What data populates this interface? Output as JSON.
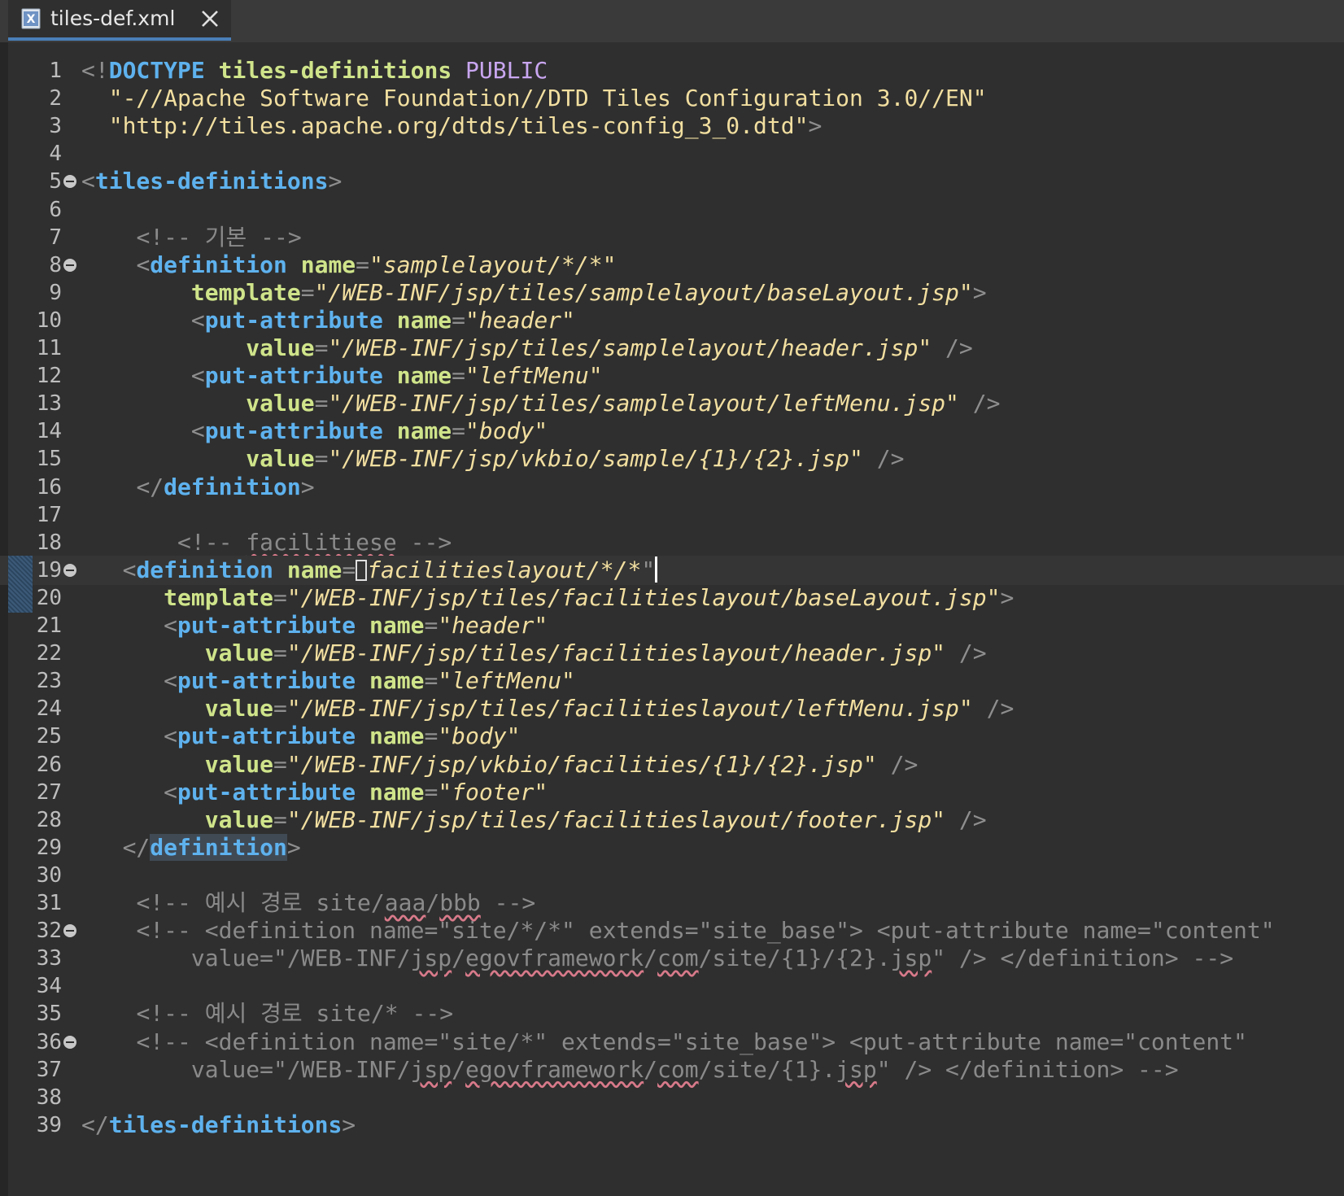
{
  "tab": {
    "filename": "tiles-def.xml",
    "icon": "xml-file-icon",
    "close_icon": "close-icon"
  },
  "colors": {
    "background": "#2f2f2f",
    "tag": "#5eb2ee",
    "attribute": "#cfe48a",
    "value": "#f2dfa0",
    "comment": "#8a8a8a",
    "keyword": "#c9a6f0",
    "line_number": "#bdbdbd",
    "tab_underline": "#4a7fb8"
  },
  "editor": {
    "current_line": 19,
    "lines": [
      {
        "n": "1",
        "fold": false,
        "tokens": [
          [
            "br",
            "<!"
          ],
          [
            "tag",
            "DOCTYPE"
          ],
          [
            "txt",
            " "
          ],
          [
            "attr",
            "tiles-definitions"
          ],
          [
            "txt",
            " "
          ],
          [
            "kw",
            "PUBLIC"
          ]
        ]
      },
      {
        "n": "2",
        "fold": false,
        "tokens": [
          [
            "txt",
            "  "
          ],
          [
            "dt",
            "\"-//Apache Software Foundation//DTD Tiles Configuration 3.0//EN\""
          ]
        ]
      },
      {
        "n": "3",
        "fold": false,
        "tokens": [
          [
            "txt",
            "  "
          ],
          [
            "dt",
            "\"http://tiles.apache.org/dtds/tiles-config_3_0.dtd\""
          ],
          [
            "br",
            ">"
          ]
        ]
      },
      {
        "n": "4",
        "fold": false,
        "tokens": []
      },
      {
        "n": "5",
        "fold": true,
        "tokens": [
          [
            "br",
            "<"
          ],
          [
            "tag",
            "tiles-definitions"
          ],
          [
            "br",
            ">"
          ]
        ]
      },
      {
        "n": "6",
        "fold": false,
        "tokens": []
      },
      {
        "n": "7",
        "fold": false,
        "tokens": [
          [
            "txt",
            "    "
          ],
          [
            "cm",
            "<!-- 기본 -->"
          ]
        ]
      },
      {
        "n": "8",
        "fold": true,
        "tokens": [
          [
            "txt",
            "    "
          ],
          [
            "br",
            "<"
          ],
          [
            "tag",
            "definition"
          ],
          [
            "txt",
            " "
          ],
          [
            "attr",
            "name"
          ],
          [
            "br",
            "="
          ],
          [
            "val",
            "\"samplelayout/*/*\""
          ]
        ]
      },
      {
        "n": "9",
        "fold": false,
        "tokens": [
          [
            "txt",
            "        "
          ],
          [
            "attr",
            "template"
          ],
          [
            "br",
            "="
          ],
          [
            "val",
            "\"/WEB-INF/jsp/tiles/samplelayout/baseLayout.jsp\""
          ],
          [
            "br",
            ">"
          ]
        ]
      },
      {
        "n": "10",
        "fold": false,
        "tokens": [
          [
            "txt",
            "        "
          ],
          [
            "br",
            "<"
          ],
          [
            "tag",
            "put-attribute"
          ],
          [
            "txt",
            " "
          ],
          [
            "attr",
            "name"
          ],
          [
            "br",
            "="
          ],
          [
            "val",
            "\"header\""
          ]
        ]
      },
      {
        "n": "11",
        "fold": false,
        "tokens": [
          [
            "txt",
            "            "
          ],
          [
            "attr",
            "value"
          ],
          [
            "br",
            "="
          ],
          [
            "val",
            "\"/WEB-INF/jsp/tiles/samplelayout/header.jsp\""
          ],
          [
            "txt",
            " "
          ],
          [
            "br",
            "/>"
          ]
        ]
      },
      {
        "n": "12",
        "fold": false,
        "tokens": [
          [
            "txt",
            "        "
          ],
          [
            "br",
            "<"
          ],
          [
            "tag",
            "put-attribute"
          ],
          [
            "txt",
            " "
          ],
          [
            "attr",
            "name"
          ],
          [
            "br",
            "="
          ],
          [
            "val",
            "\"leftMenu\""
          ]
        ]
      },
      {
        "n": "13",
        "fold": false,
        "tokens": [
          [
            "txt",
            "            "
          ],
          [
            "attr",
            "value"
          ],
          [
            "br",
            "="
          ],
          [
            "val",
            "\"/WEB-INF/jsp/tiles/samplelayout/leftMenu.jsp\""
          ],
          [
            "txt",
            " "
          ],
          [
            "br",
            "/>"
          ]
        ]
      },
      {
        "n": "14",
        "fold": false,
        "tokens": [
          [
            "txt",
            "        "
          ],
          [
            "br",
            "<"
          ],
          [
            "tag",
            "put-attribute"
          ],
          [
            "txt",
            " "
          ],
          [
            "attr",
            "name"
          ],
          [
            "br",
            "="
          ],
          [
            "val",
            "\"body\""
          ]
        ]
      },
      {
        "n": "15",
        "fold": false,
        "tokens": [
          [
            "txt",
            "            "
          ],
          [
            "attr",
            "value"
          ],
          [
            "br",
            "="
          ],
          [
            "val",
            "\"/WEB-INF/jsp/vkbio/sample/{1}/{2}.jsp\""
          ],
          [
            "txt",
            " "
          ],
          [
            "br",
            "/>"
          ]
        ]
      },
      {
        "n": "16",
        "fold": false,
        "tokens": [
          [
            "txt",
            "    "
          ],
          [
            "br",
            "</"
          ],
          [
            "tag",
            "definition"
          ],
          [
            "br",
            ">"
          ]
        ]
      },
      {
        "n": "17",
        "fold": false,
        "tokens": []
      },
      {
        "n": "18",
        "fold": false,
        "tokens": [
          [
            "txt",
            "       "
          ],
          [
            "cm",
            "<!-- "
          ],
          [
            "cmsq",
            "facilitiese"
          ],
          [
            "cm",
            " -->"
          ]
        ]
      },
      {
        "n": "19",
        "fold": true,
        "tokens": [
          [
            "txt",
            "   "
          ],
          [
            "br",
            "<"
          ],
          [
            "tag",
            "definition"
          ],
          [
            "txt",
            " "
          ],
          [
            "attr",
            "name"
          ],
          [
            "br",
            "="
          ],
          [
            "cursorbox",
            ""
          ],
          [
            "val",
            "facilitieslayout/*/*"
          ],
          [
            "br",
            "\""
          ],
          [
            "caret",
            ""
          ]
        ]
      },
      {
        "n": "20",
        "fold": false,
        "tokens": [
          [
            "txt",
            "      "
          ],
          [
            "attr",
            "template"
          ],
          [
            "br",
            "="
          ],
          [
            "val",
            "\"/WEB-INF/jsp/tiles/facilitieslayout/baseLayout.jsp\""
          ],
          [
            "br",
            ">"
          ]
        ]
      },
      {
        "n": "21",
        "fold": false,
        "tokens": [
          [
            "txt",
            "      "
          ],
          [
            "br",
            "<"
          ],
          [
            "tag",
            "put-attribute"
          ],
          [
            "txt",
            " "
          ],
          [
            "attr",
            "name"
          ],
          [
            "br",
            "="
          ],
          [
            "val",
            "\"header\""
          ]
        ]
      },
      {
        "n": "22",
        "fold": false,
        "tokens": [
          [
            "txt",
            "         "
          ],
          [
            "attr",
            "value"
          ],
          [
            "br",
            "="
          ],
          [
            "val",
            "\"/WEB-INF/jsp/tiles/facilitieslayout/header.jsp\""
          ],
          [
            "txt",
            " "
          ],
          [
            "br",
            "/>"
          ]
        ]
      },
      {
        "n": "23",
        "fold": false,
        "tokens": [
          [
            "txt",
            "      "
          ],
          [
            "br",
            "<"
          ],
          [
            "tag",
            "put-attribute"
          ],
          [
            "txt",
            " "
          ],
          [
            "attr",
            "name"
          ],
          [
            "br",
            "="
          ],
          [
            "val",
            "\"leftMenu\""
          ]
        ]
      },
      {
        "n": "24",
        "fold": false,
        "tokens": [
          [
            "txt",
            "         "
          ],
          [
            "attr",
            "value"
          ],
          [
            "br",
            "="
          ],
          [
            "val",
            "\"/WEB-INF/jsp/tiles/facilitieslayout/leftMenu.jsp\""
          ],
          [
            "txt",
            " "
          ],
          [
            "br",
            "/>"
          ]
        ]
      },
      {
        "n": "25",
        "fold": false,
        "tokens": [
          [
            "txt",
            "      "
          ],
          [
            "br",
            "<"
          ],
          [
            "tag",
            "put-attribute"
          ],
          [
            "txt",
            " "
          ],
          [
            "attr",
            "name"
          ],
          [
            "br",
            "="
          ],
          [
            "val",
            "\"body\""
          ]
        ]
      },
      {
        "n": "26",
        "fold": false,
        "tokens": [
          [
            "txt",
            "         "
          ],
          [
            "attr",
            "value"
          ],
          [
            "br",
            "="
          ],
          [
            "val",
            "\"/WEB-INF/jsp/vkbio/facilities/{1}/{2}.jsp\""
          ],
          [
            "txt",
            " "
          ],
          [
            "br",
            "/>"
          ]
        ]
      },
      {
        "n": "27",
        "fold": false,
        "tokens": [
          [
            "txt",
            "      "
          ],
          [
            "br",
            "<"
          ],
          [
            "tag",
            "put-attribute"
          ],
          [
            "txt",
            " "
          ],
          [
            "attr",
            "name"
          ],
          [
            "br",
            "="
          ],
          [
            "val",
            "\"footer\""
          ]
        ]
      },
      {
        "n": "28",
        "fold": false,
        "tokens": [
          [
            "txt",
            "         "
          ],
          [
            "attr",
            "value"
          ],
          [
            "br",
            "="
          ],
          [
            "val",
            "\"/WEB-INF/jsp/tiles/facilitieslayout/footer.jsp\""
          ],
          [
            "txt",
            " "
          ],
          [
            "br",
            "/>"
          ]
        ]
      },
      {
        "n": "29",
        "fold": false,
        "tokens": [
          [
            "txt",
            "   "
          ],
          [
            "br",
            "</"
          ],
          [
            "tagsel",
            "definition"
          ],
          [
            "br",
            ">"
          ]
        ]
      },
      {
        "n": "30",
        "fold": false,
        "tokens": []
      },
      {
        "n": "31",
        "fold": false,
        "tokens": [
          [
            "txt",
            "    "
          ],
          [
            "cm",
            "<!-- 예시 경로 site/"
          ],
          [
            "cmsq",
            "aaa"
          ],
          [
            "cm",
            "/"
          ],
          [
            "cmsq",
            "bbb"
          ],
          [
            "cm",
            " -->"
          ]
        ]
      },
      {
        "n": "32",
        "fold": true,
        "tokens": [
          [
            "txt",
            "    "
          ],
          [
            "cm",
            "<!-- <definition name=\"site/*/*\" extends=\"site_base\"> <put-attribute name=\"content\""
          ]
        ]
      },
      {
        "n": "33",
        "fold": false,
        "tokens": [
          [
            "txt",
            "        "
          ],
          [
            "cm",
            "value=\"/WEB-INF/"
          ],
          [
            "cmsq",
            "jsp"
          ],
          [
            "cm",
            "/"
          ],
          [
            "cmsq",
            "egovframework"
          ],
          [
            "cm",
            "/"
          ],
          [
            "cmsq",
            "com"
          ],
          [
            "cm",
            "/site/{1}/{2}."
          ],
          [
            "cmsq",
            "jsp"
          ],
          [
            "cm",
            "\" /> </definition> -->"
          ]
        ]
      },
      {
        "n": "34",
        "fold": false,
        "tokens": []
      },
      {
        "n": "35",
        "fold": false,
        "tokens": [
          [
            "txt",
            "    "
          ],
          [
            "cm",
            "<!-- 예시 경로 site/* -->"
          ]
        ]
      },
      {
        "n": "36",
        "fold": true,
        "tokens": [
          [
            "txt",
            "    "
          ],
          [
            "cm",
            "<!-- <definition name=\"site/*\" extends=\"site_base\"> <put-attribute name=\"content\""
          ]
        ]
      },
      {
        "n": "37",
        "fold": false,
        "tokens": [
          [
            "txt",
            "        "
          ],
          [
            "cm",
            "value=\"/WEB-INF/"
          ],
          [
            "cmsq",
            "jsp"
          ],
          [
            "cm",
            "/"
          ],
          [
            "cmsq",
            "egovframework"
          ],
          [
            "cm",
            "/"
          ],
          [
            "cmsq",
            "com"
          ],
          [
            "cm",
            "/site/{1}."
          ],
          [
            "cmsq",
            "jsp"
          ],
          [
            "cm",
            "\" /> </definition> -->"
          ]
        ]
      },
      {
        "n": "38",
        "fold": false,
        "tokens": []
      },
      {
        "n": "39",
        "fold": false,
        "tokens": [
          [
            "br",
            "</"
          ],
          [
            "tag",
            "tiles-definitions"
          ],
          [
            "br",
            ">"
          ]
        ]
      }
    ]
  }
}
